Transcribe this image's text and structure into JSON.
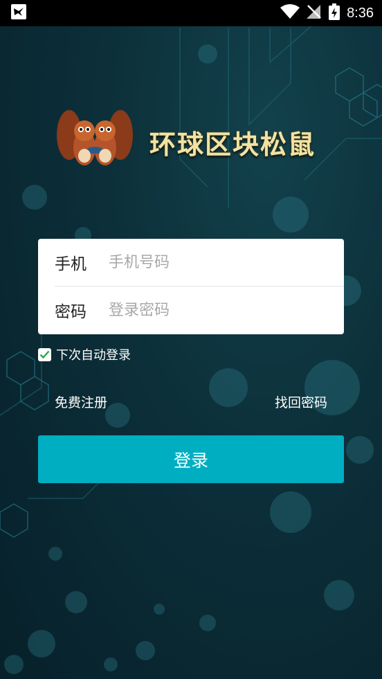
{
  "status_bar": {
    "time": "8:36"
  },
  "brand": {
    "title": "环球区块松鼠"
  },
  "login_form": {
    "phone_label": "手机",
    "phone_placeholder": "手机号码",
    "password_label": "密码",
    "password_placeholder": "登录密码"
  },
  "remember_me": {
    "label": "下次自动登录",
    "checked": true
  },
  "links": {
    "register": "免费注册",
    "forgot_password": "找回密码"
  },
  "login_button": {
    "label": "登录"
  },
  "colors": {
    "accent": "#00aec2",
    "background": "#0c2f39",
    "checkbox_check": "#2aa84a"
  }
}
